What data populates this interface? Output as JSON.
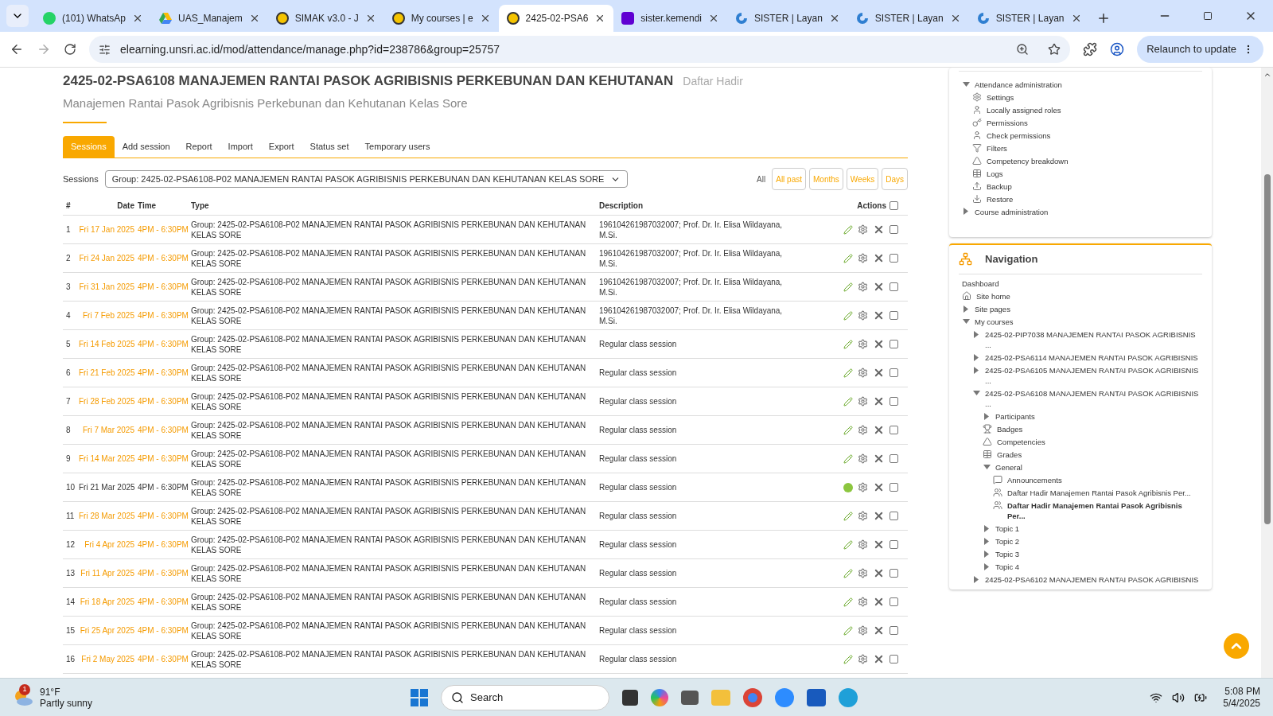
{
  "browser": {
    "tabs": [
      {
        "title": "(101) WhatsAp",
        "kind": "whatsapp",
        "selected": false
      },
      {
        "title": "UAS_Manajem",
        "kind": "drive",
        "selected": false
      },
      {
        "title": "SIMAK v3.0 - J",
        "kind": "unsri",
        "selected": false
      },
      {
        "title": "My courses | e",
        "kind": "unsri",
        "selected": false
      },
      {
        "title": "2425-02-PSA6",
        "kind": "unsri",
        "selected": true
      },
      {
        "title": "sister.kemendi",
        "kind": "yahoo",
        "selected": false
      },
      {
        "title": "SISTER | Layan",
        "kind": "sister",
        "selected": false
      },
      {
        "title": "SISTER | Layan",
        "kind": "sister",
        "selected": false
      },
      {
        "title": "SISTER | Layan",
        "kind": "sister",
        "selected": false
      }
    ],
    "url": "elearning.unsri.ac.id/mod/attendance/manage.php?id=238786&group=25757",
    "relaunch_button": "Relaunch to update"
  },
  "page": {
    "heading": "2425-02-PSA6108 MANAJEMEN RANTAI PASOK AGRIBISNIS PERKEBUNAN DAN KEHUTANAN",
    "heading_suffix": "Daftar Hadir",
    "subtitle": "Manajemen Rantai Pasok Agribisnis Perkebunan dan Kehutanan Kelas Sore",
    "tabs": [
      {
        "label": "Sessions",
        "selected": true
      },
      {
        "label": "Add session",
        "selected": false
      },
      {
        "label": "Report",
        "selected": false
      },
      {
        "label": "Import",
        "selected": false
      },
      {
        "label": "Export",
        "selected": false
      },
      {
        "label": "Status set",
        "selected": false
      },
      {
        "label": "Temporary users",
        "selected": false
      }
    ],
    "sessions_label": "Sessions",
    "group_select": "Group: 2425-02-PSA6108-P02 MANAJEMEN RANTAI PASOK AGRIBISNIS PERKEBUNAN DAN KEHUTANAN KELAS SORE",
    "filters": [
      {
        "label": "All",
        "selected": true
      },
      {
        "label": "All past",
        "selected": false
      },
      {
        "label": "Months",
        "selected": false
      },
      {
        "label": "Weeks",
        "selected": false
      },
      {
        "label": "Days",
        "selected": false
      }
    ],
    "columns": [
      "#",
      "Date",
      "Time",
      "Type",
      "Description",
      "Actions"
    ],
    "select_all_checked": false,
    "rows": [
      {
        "num": "1",
        "date": "Fri 17 Jan 2025",
        "time": "4PM - 6:30PM",
        "type": "Group: 2425-02-PSA6108-P02 MANAJEMEN RANTAI PASOK AGRIBISNIS PERKEBUNAN DAN KEHUTANAN KELAS SORE",
        "description": "196104261987032007; Prof. Dr. Ir. Elisa Wildayana, M.Si.",
        "current": false,
        "checked": false
      },
      {
        "num": "2",
        "date": "Fri 24 Jan 2025",
        "time": "4PM - 6:30PM",
        "type": "Group: 2425-02-PSA6108-P02 MANAJEMEN RANTAI PASOK AGRIBISNIS PERKEBUNAN DAN KEHUTANAN KELAS SORE",
        "description": "196104261987032007; Prof. Dr. Ir. Elisa Wildayana, M.Si.",
        "current": false,
        "checked": false
      },
      {
        "num": "3",
        "date": "Fri 31 Jan 2025",
        "time": "4PM - 6:30PM",
        "type": "Group: 2425-02-PSA6108-P02 MANAJEMEN RANTAI PASOK AGRIBISNIS PERKEBUNAN DAN KEHUTANAN KELAS SORE",
        "description": "196104261987032007; Prof. Dr. Ir. Elisa Wildayana, M.Si.",
        "current": false,
        "checked": false
      },
      {
        "num": "4",
        "date": "Fri 7 Feb 2025",
        "time": "4PM - 6:30PM",
        "type": "Group: 2425-02-PSA6108-P02 MANAJEMEN RANTAI PASOK AGRIBISNIS PERKEBUNAN DAN KEHUTANAN KELAS SORE",
        "description": "196104261987032007; Prof. Dr. Ir. Elisa Wildayana, M.Si.",
        "current": false,
        "checked": false
      },
      {
        "num": "5",
        "date": "Fri 14 Feb 2025",
        "time": "4PM - 6:30PM",
        "type": "Group: 2425-02-PSA6108-P02 MANAJEMEN RANTAI PASOK AGRIBISNIS PERKEBUNAN DAN KEHUTANAN KELAS SORE",
        "description": "Regular class session",
        "current": false,
        "checked": false
      },
      {
        "num": "6",
        "date": "Fri 21 Feb 2025",
        "time": "4PM - 6:30PM",
        "type": "Group: 2425-02-PSA6108-P02 MANAJEMEN RANTAI PASOK AGRIBISNIS PERKEBUNAN DAN KEHUTANAN KELAS SORE",
        "description": "Regular class session",
        "current": false,
        "checked": false
      },
      {
        "num": "7",
        "date": "Fri 28 Feb 2025",
        "time": "4PM - 6:30PM",
        "type": "Group: 2425-02-PSA6108-P02 MANAJEMEN RANTAI PASOK AGRIBISNIS PERKEBUNAN DAN KEHUTANAN KELAS SORE",
        "description": "Regular class session",
        "current": false,
        "checked": false
      },
      {
        "num": "8",
        "date": "Fri 7 Mar 2025",
        "time": "4PM - 6:30PM",
        "type": "Group: 2425-02-PSA6108-P02 MANAJEMEN RANTAI PASOK AGRIBISNIS PERKEBUNAN DAN KEHUTANAN KELAS SORE",
        "description": "Regular class session",
        "current": false,
        "checked": false
      },
      {
        "num": "9",
        "date": "Fri 14 Mar 2025",
        "time": "4PM - 6:30PM",
        "type": "Group: 2425-02-PSA6108-P02 MANAJEMEN RANTAI PASOK AGRIBISNIS PERKEBUNAN DAN KEHUTANAN KELAS SORE",
        "description": "Regular class session",
        "current": false,
        "checked": false
      },
      {
        "num": "10",
        "date": "Fri 21 Mar 2025",
        "time": "4PM - 6:30PM",
        "type": "Group: 2425-02-PSA6108-P02 MANAJEMEN RANTAI PASOK AGRIBISNIS PERKEBUNAN DAN KEHUTANAN KELAS SORE",
        "description": "Regular class session",
        "current": true,
        "checked": false
      },
      {
        "num": "11",
        "date": "Fri 28 Mar 2025",
        "time": "4PM - 6:30PM",
        "type": "Group: 2425-02-PSA6108-P02 MANAJEMEN RANTAI PASOK AGRIBISNIS PERKEBUNAN DAN KEHUTANAN KELAS SORE",
        "description": "Regular class session",
        "current": false,
        "checked": false
      },
      {
        "num": "12",
        "date": "Fri 4 Apr 2025",
        "time": "4PM - 6:30PM",
        "type": "Group: 2425-02-PSA6108-P02 MANAJEMEN RANTAI PASOK AGRIBISNIS PERKEBUNAN DAN KEHUTANAN KELAS SORE",
        "description": "Regular class session",
        "current": false,
        "checked": false
      },
      {
        "num": "13",
        "date": "Fri 11 Apr 2025",
        "time": "4PM - 6:30PM",
        "type": "Group: 2425-02-PSA6108-P02 MANAJEMEN RANTAI PASOK AGRIBISNIS PERKEBUNAN DAN KEHUTANAN KELAS SORE",
        "description": "Regular class session",
        "current": false,
        "checked": false
      },
      {
        "num": "14",
        "date": "Fri 18 Apr 2025",
        "time": "4PM - 6:30PM",
        "type": "Group: 2425-02-PSA6108-P02 MANAJEMEN RANTAI PASOK AGRIBISNIS PERKEBUNAN DAN KEHUTANAN KELAS SORE",
        "description": "Regular class session",
        "current": false,
        "checked": false
      },
      {
        "num": "15",
        "date": "Fri 25 Apr 2025",
        "time": "4PM - 6:30PM",
        "type": "Group: 2425-02-PSA6108-P02 MANAJEMEN RANTAI PASOK AGRIBISNIS PERKEBUNAN DAN KEHUTANAN KELAS SORE",
        "description": "Regular class session",
        "current": false,
        "checked": false
      },
      {
        "num": "16",
        "date": "Fri 2 May 2025",
        "time": "4PM - 6:30PM",
        "type": "Group: 2425-02-PSA6108-P02 MANAJEMEN RANTAI PASOK AGRIBISNIS PERKEBUNAN DAN KEHUTANAN KELAS SORE",
        "description": "Regular class session",
        "current": false,
        "checked": false
      }
    ]
  },
  "administration": [
    {
      "label": "Attendance administration",
      "kind": "branch",
      "expanded": true,
      "children": [
        {
          "label": "Settings",
          "kind": "settings"
        },
        {
          "label": "Locally assigned roles",
          "kind": "user"
        },
        {
          "label": "Permissions",
          "kind": "key"
        },
        {
          "label": "Check permissions",
          "kind": "user"
        },
        {
          "label": "Filters",
          "kind": "filter"
        },
        {
          "label": "Competency breakdown",
          "kind": "competency"
        },
        {
          "label": "Logs",
          "kind": "grid"
        },
        {
          "label": "Backup",
          "kind": "upload"
        },
        {
          "label": "Restore",
          "kind": "download"
        }
      ]
    },
    {
      "label": "Course administration",
      "kind": "branch",
      "expanded": false
    }
  ],
  "navigation": {
    "title": "Navigation",
    "items": [
      {
        "label": "Dashboard",
        "kind": "plain"
      },
      {
        "label": "Site home",
        "kind": "home"
      },
      {
        "label": "Site pages",
        "kind": "branch",
        "expanded": false
      },
      {
        "label": "My courses",
        "kind": "branch",
        "expanded": true,
        "children": [
          {
            "label": "2425-02-PIP7038 MANAJEMEN RANTAI PASOK AGRIBISNIS ...",
            "kind": "branch",
            "expanded": false
          },
          {
            "label": "2425-02-PSA6114 MANAJEMEN RANTAI PASOK AGRIBISNIS",
            "kind": "branch",
            "expanded": false
          },
          {
            "label": "2425-02-PSA6105 MANAJEMEN RANTAI PASOK AGRIBISNIS ...",
            "kind": "branch",
            "expanded": false
          },
          {
            "label": "2425-02-PSA6108 MANAJEMEN RANTAI PASOK AGRIBISNIS ...",
            "kind": "branch",
            "expanded": true,
            "children": [
              {
                "label": "Participants",
                "kind": "branch",
                "expanded": false
              },
              {
                "label": "Badges",
                "kind": "trophy"
              },
              {
                "label": "Competencies",
                "kind": "competency"
              },
              {
                "label": "Grades",
                "kind": "grid"
              },
              {
                "label": "General",
                "kind": "branch",
                "expanded": true,
                "children": [
                  {
                    "label": "Announcements",
                    "kind": "forum"
                  },
                  {
                    "label": "Daftar Hadir Manajemen Rantai Pasok Agribisnis Per...",
                    "kind": "attendance",
                    "current": false
                  },
                  {
                    "label": "Daftar Hadir Manajemen Rantai Pasok Agribisnis Per...",
                    "kind": "attendance",
                    "current": true
                  }
                ]
              },
              {
                "label": "Topic 1",
                "kind": "branch",
                "expanded": false
              },
              {
                "label": "Topic 2",
                "kind": "branch",
                "expanded": false
              },
              {
                "label": "Topic 3",
                "kind": "branch",
                "expanded": false
              },
              {
                "label": "Topic 4",
                "kind": "branch",
                "expanded": false
              }
            ]
          },
          {
            "label": "2425-02-PSA6102 MANAJEMEN RANTAI PASOK AGRIBISNIS",
            "kind": "branch",
            "expanded": false
          }
        ]
      }
    ]
  },
  "taskbar": {
    "weather_badge": "1",
    "temperature": "91°F",
    "weather": "Partly sunny",
    "search": "Search",
    "time": "5:08 PM",
    "date": "5/4/2025"
  }
}
